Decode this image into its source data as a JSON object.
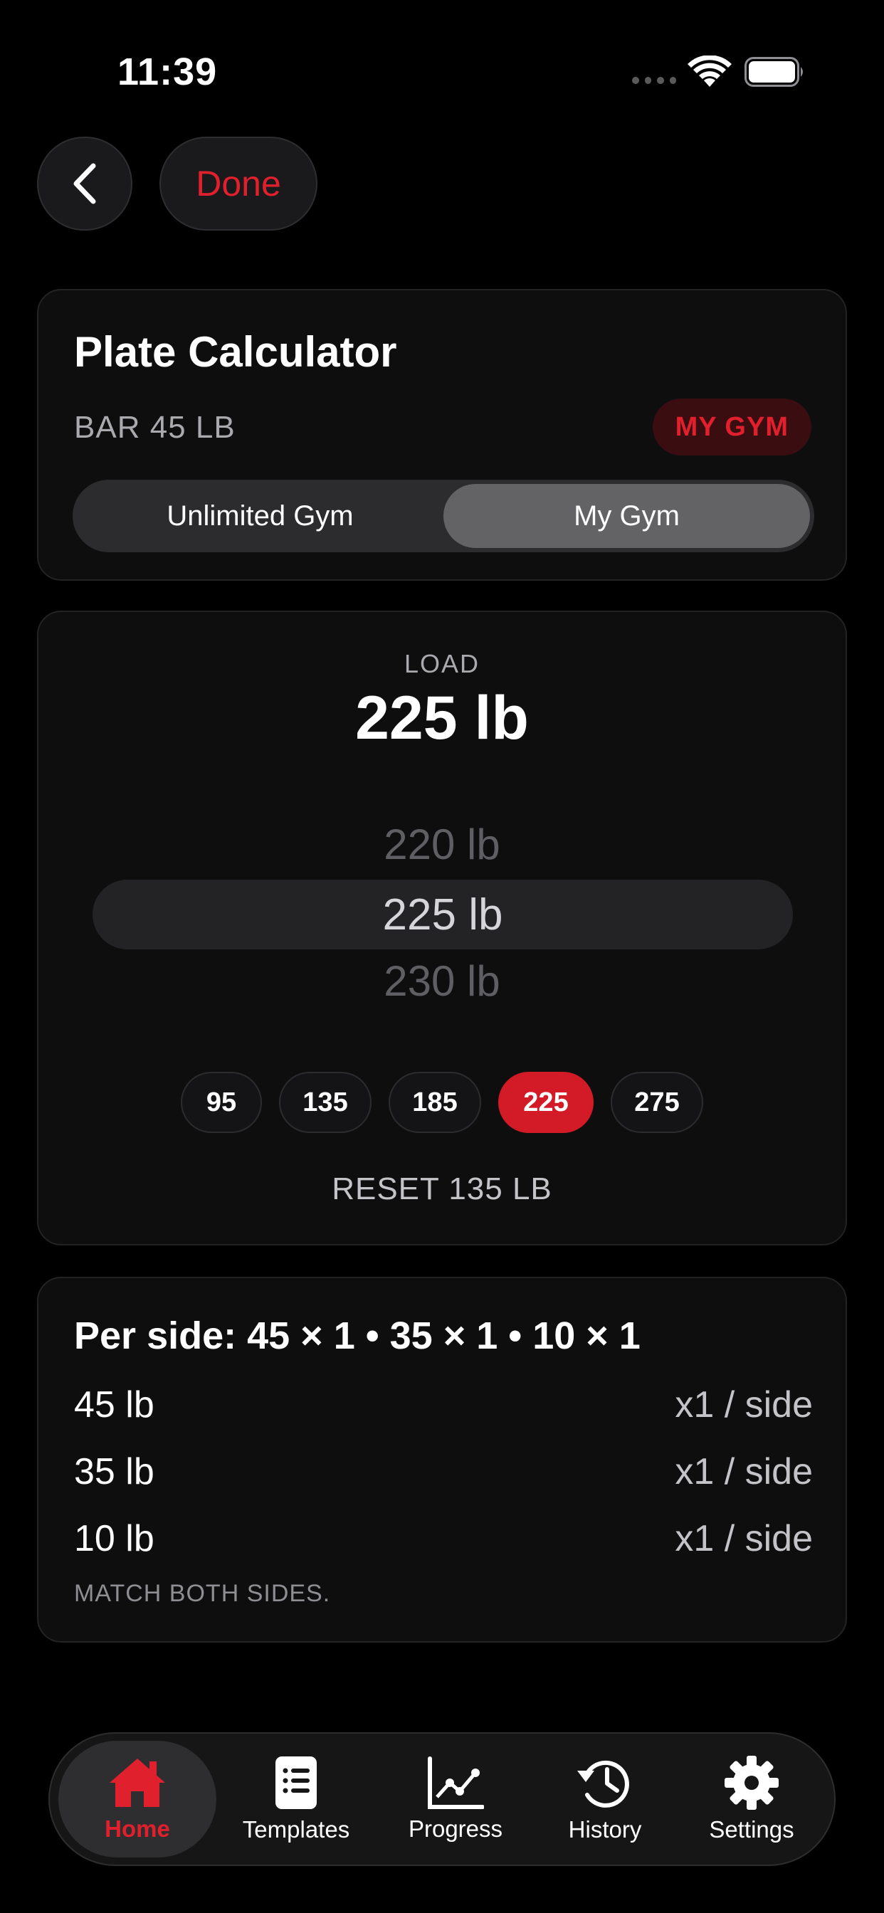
{
  "status_bar": {
    "time": "11:39"
  },
  "header": {
    "done_label": "Done"
  },
  "calculator": {
    "title": "Plate Calculator",
    "bar_label": "BAR 45 LB",
    "badge": "MY GYM",
    "segments": [
      "Unlimited Gym",
      "My Gym"
    ],
    "selected_segment": "My Gym"
  },
  "load": {
    "label": "LOAD",
    "value": "225 lb",
    "picker_above": "220 lb",
    "picker_selected": "225 lb",
    "picker_below": "230 lb",
    "presets": [
      "95",
      "135",
      "185",
      "225",
      "275"
    ],
    "selected_preset": "225",
    "reset_label": "RESET 135 LB"
  },
  "plates": {
    "summary": "Per side: 45 × 1 • 35 × 1 • 10 × 1",
    "rows": [
      {
        "weight": "45 lb",
        "qty": "x1 / side"
      },
      {
        "weight": "35 lb",
        "qty": "x1 / side"
      },
      {
        "weight": "10 lb",
        "qty": "x1 / side"
      }
    ],
    "footnote": "MATCH BOTH SIDES."
  },
  "tabbar": {
    "items": [
      {
        "label": "Home",
        "icon": "home-icon"
      },
      {
        "label": "Templates",
        "icon": "list-icon"
      },
      {
        "label": "Progress",
        "icon": "chart-icon"
      },
      {
        "label": "History",
        "icon": "history-icon"
      },
      {
        "label": "Settings",
        "icon": "gear-icon"
      }
    ],
    "active": "Home"
  },
  "colors": {
    "accent": "#e0202c",
    "background": "#000000",
    "card": "#0e0e0f"
  }
}
